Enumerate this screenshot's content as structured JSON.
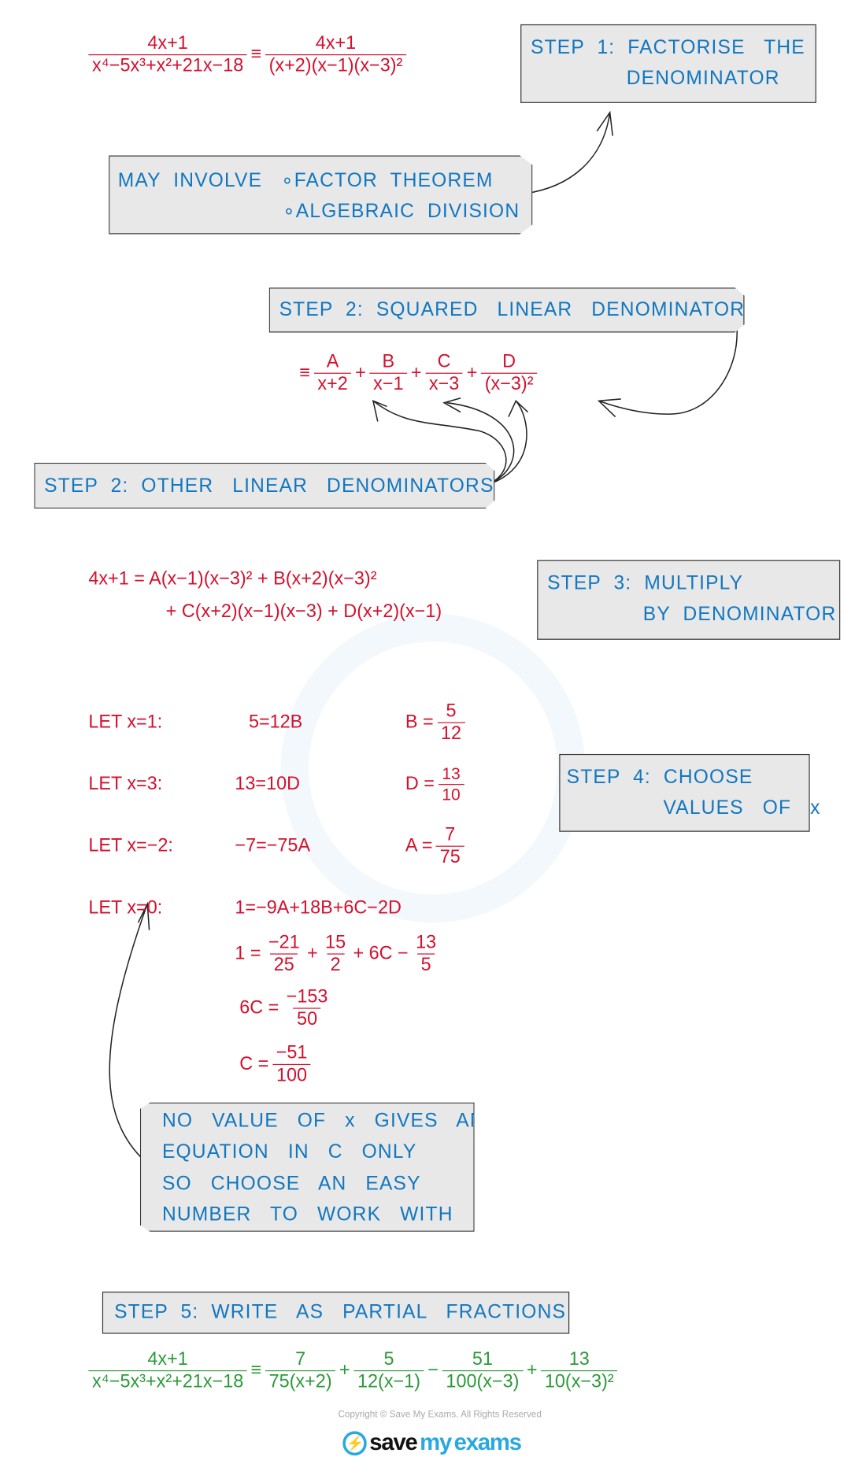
{
  "colors": {
    "working": "#d4112e",
    "annotation": "#1177c0",
    "answer": "#2c9a3a",
    "box_fill": "#e8e8e8"
  },
  "eq1": {
    "lhs_num": "4x+1",
    "lhs_den": "x⁴−5x³+x²+21x−18",
    "equiv": "≡",
    "rhs_num": "4x+1",
    "rhs_den": "(x+2)(x−1)(x−3)²"
  },
  "step1": {
    "line1": "STEP  1:  FACTORISE   THE",
    "line2": "DENOMINATOR"
  },
  "note_factor": {
    "line1": "MAY  INVOLVE   ∘FACTOR  THEOREM",
    "line2": "∘ALGEBRAIC  DIVISION"
  },
  "step2a": {
    "text": "STEP  2:  SQUARED   LINEAR   DENOMINATOR"
  },
  "partial": {
    "equiv": "≡",
    "plus": "+",
    "t1_num": "A",
    "t1_den": "x+2",
    "t2_num": "B",
    "t2_den": "x−1",
    "t3_num": "C",
    "t3_den": "x−3",
    "t4_num": "D",
    "t4_den": "(x−3)²"
  },
  "step2b": {
    "text": "STEP  2:  OTHER   LINEAR   DENOMINATORS"
  },
  "eq3": {
    "line1": "4x+1 = A(x−1)(x−3)² + B(x+2)(x−3)²",
    "line2": "+ C(x+2)(x−1)(x−3) + D(x+2)(x−1)"
  },
  "step3": {
    "line1": "STEP  3:  MULTIPLY",
    "line2": "BY  DENOMINATOR"
  },
  "lets": [
    {
      "label": "LET  x=1:",
      "eq": "5=12B",
      "var": "B =",
      "num": "5",
      "den": "12"
    },
    {
      "label": "LET  x=3:",
      "eq": "13=10D",
      "var": "D =",
      "num": "13",
      "den": "10"
    },
    {
      "label": "LET  x=−2:",
      "eq": "−7=−75A",
      "var": "A =",
      "num": "7",
      "den": "75"
    },
    {
      "label": "LET  x=0:",
      "eq": "1=−9A+18B+6C−2D"
    }
  ],
  "work": {
    "l1_lhs": "1 =",
    "f1_num": "−21",
    "f1_den": "25",
    "plus": "+",
    "f2_num": "15",
    "f2_den": "2",
    "mid": "+ 6C −",
    "f3_num": "13",
    "f3_den": "5",
    "l2_lhs": "6C =",
    "f4_num": "−153",
    "f4_den": "50",
    "l3_lhs": "C =",
    "f5_num": "−51",
    "f5_den": "100"
  },
  "step4": {
    "line1": "STEP  4:  CHOOSE",
    "line2": "VALUES   OF   x"
  },
  "note_c": {
    "lines": [
      "NO   VALUE   OF   x   GIVES   AN",
      "EQUATION   IN   C   ONLY",
      "SO   CHOOSE   AN   EASY",
      "NUMBER   TO   WORK   WITH"
    ]
  },
  "step5": {
    "text": "STEP  5:  WRITE   AS   PARTIAL   FRACTIONS"
  },
  "final": {
    "lhs_num": "4x+1",
    "lhs_den": "x⁴−5x³+x²+21x−18",
    "equiv": "≡",
    "t1_num": "7",
    "t1_den": "75(x+2)",
    "op1": "+",
    "t2_num": "5",
    "t2_den": "12(x−1)",
    "op2": "−",
    "t3_num": "51",
    "t3_den": "100(x−3)",
    "op3": "+",
    "t4_num": "13",
    "t4_den": "10(x−3)²"
  },
  "footer": {
    "copyright": "Copyright © Save My Exams. All Rights Reserved",
    "logo_save": "save",
    "logo_my": "my",
    "logo_exams": "exams"
  }
}
